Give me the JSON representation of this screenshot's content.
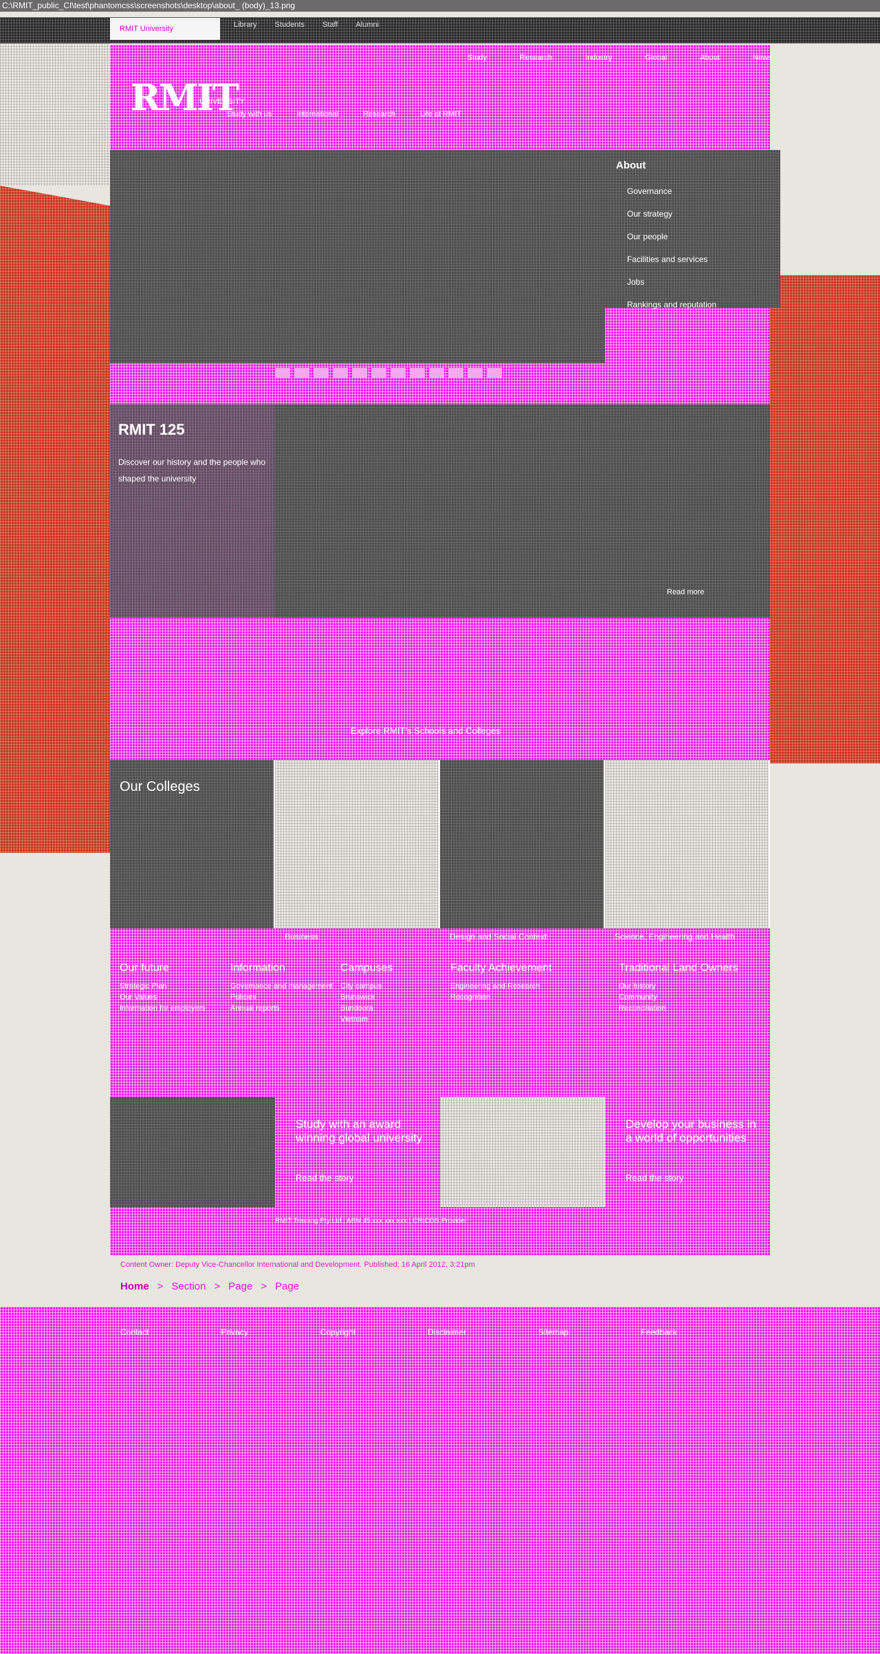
{
  "window": {
    "title": "C:\\RMIT_public_CI\\test\\phantomcss\\screenshots\\desktop\\about_ (body)_13.png"
  },
  "colors": {
    "magenta": "#ec1ee6",
    "red": "#c9371f",
    "dark": "#4e4e4e",
    "background": "#e7e6df"
  },
  "topbar": {
    "active_tab": "RMIT University",
    "links": [
      "Library",
      "Students",
      "Staff",
      "Alumni"
    ]
  },
  "header": {
    "logo": "RMIT",
    "logo_sub": "UNIVERSITY",
    "nav": [
      "Study",
      "Research",
      "Industry",
      "Global",
      "About",
      "News"
    ],
    "sub_nav": [
      "Study with us",
      "International",
      "Research",
      "Life at RMIT"
    ]
  },
  "about_menu": {
    "title": "About",
    "items": [
      "Governance",
      "Our strategy",
      "Our people",
      "Facilities and services",
      "Jobs",
      "Rankings and reputation"
    ]
  },
  "feature": {
    "title": "RMIT 125",
    "body": "Discover our history and the people who shaped the university"
  },
  "hero_caption": "Read more",
  "promo_line": "Explore RMIT's Schools and Colleges",
  "colleges": {
    "title": "Our Colleges",
    "labels": [
      "Business",
      "Design and Social Context",
      "Science, Engineering and Health"
    ]
  },
  "bottom": {
    "col1": {
      "title": "Our future",
      "items": [
        "Strategic Plan",
        "Our Values",
        "Information for employers"
      ]
    },
    "col2": {
      "title": "Information",
      "items": [
        "Governance and management",
        "Policies",
        "Annual reports"
      ]
    },
    "col3": {
      "title": "Campuses",
      "items": [
        "City campus",
        "Brunswick",
        "Bundoora",
        "Vietnam"
      ]
    },
    "col4": {
      "title": "Faculty Achievement",
      "items": [
        "Engineering and Research",
        "Recognition"
      ]
    },
    "col5": {
      "title": "Traditional Land Owners",
      "items": [
        "Our history",
        "Community",
        "Reconciliation"
      ]
    }
  },
  "promo2": {
    "left_text": "Study with an award winning global university",
    "left_link": "Read the story",
    "right_text": "Develop your business in a world of opportunities",
    "right_link": "Read the story",
    "foot": "RMIT Training Pty Ltd | ABN 45 xxx xxx xxx | CRICOS Provider"
  },
  "owner": "Content Owner: Deputy Vice-Chancellor International and Development. Published: 16 April 2012, 3:21pm",
  "breadcrumb": [
    "Home",
    "Section",
    "Page",
    "Page"
  ],
  "footer": {
    "links": [
      "Contact",
      "Privacy",
      "Copyright",
      "Disclaimer",
      "Sitemap",
      "Feedback"
    ]
  }
}
